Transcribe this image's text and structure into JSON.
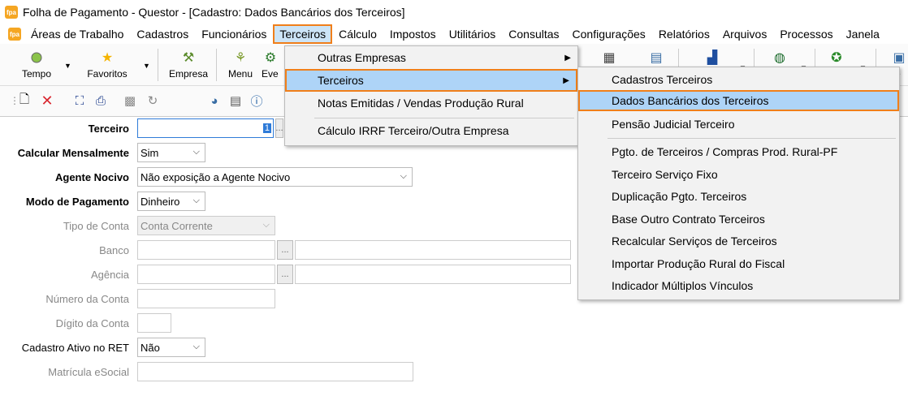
{
  "titlebar": {
    "title": "Folha de Pagamento - Questor - [Cadastro: Dados Bancários dos Terceiros]",
    "icon_text": "fpa"
  },
  "menubar": {
    "items": [
      "Áreas de Trabalho",
      "Cadastros",
      "Funcionários",
      "Terceiros",
      "Cálculo",
      "Impostos",
      "Utilitários",
      "Consultas",
      "Configurações",
      "Relatórios",
      "Arquivos",
      "Processos",
      "Janela"
    ],
    "active": "Terceiros",
    "highlight_color": "#f07f1a"
  },
  "toolbar": {
    "tempo": "Tempo",
    "favoritos": "Favoritos",
    "empresa": "Empresa",
    "menu": "Menu",
    "eventos": "Eve",
    "ve": "ve"
  },
  "menu_terceiros": {
    "items": [
      {
        "label": "Outras Empresas",
        "submenu": true
      },
      {
        "label": "Terceiros",
        "submenu": true
      },
      {
        "label": "Notas Emitidas / Vendas Produção Rural",
        "submenu": false
      },
      {
        "label": "Cálculo IRRF Terceiro/Outra Empresa",
        "submenu": false
      }
    ],
    "active": "Terceiros"
  },
  "submenu_terceiros": {
    "items": [
      "Cadastros Terceiros",
      "Dados Bancários dos Terceiros",
      "Pensão Judicial Terceiro",
      "Pgto. de Terceiros / Compras Prod. Rural-PF",
      "Terceiro Serviço Fixo",
      "Duplicação Pgto. Terceiros",
      "Base Outro Contrato Terceiros",
      "Recalcular Serviços de Terceiros",
      "Importar Produção Rural do Fiscal",
      "Indicador Múltiplos Vínculos"
    ],
    "active": "Dados Bancários dos Terceiros"
  },
  "form": {
    "terceiro": {
      "label": "Terceiro",
      "value": "",
      "caret": "1"
    },
    "calcular_mensalmente": {
      "label": "Calcular Mensalmente",
      "value": "Sim"
    },
    "agente_nocivo": {
      "label": "Agente Nocivo",
      "value": "Não exposição a Agente Nocivo"
    },
    "modo_pagamento": {
      "label": "Modo de Pagamento",
      "value": "Dinheiro"
    },
    "tipo_conta": {
      "label": "Tipo de Conta",
      "value": "Conta Corrente"
    },
    "banco": {
      "label": "Banco",
      "value": ""
    },
    "agencia": {
      "label": "Agência",
      "value": ""
    },
    "numero_conta": {
      "label": "Número da Conta",
      "value": ""
    },
    "digito_conta": {
      "label": "Dígito da Conta",
      "value": ""
    },
    "cadastro_ativo_ret": {
      "label": "Cadastro Ativo no RET",
      "value": "Não"
    },
    "matricula_esocial": {
      "label": "Matrícula eSocial",
      "value": ""
    },
    "ellipsis": "..."
  }
}
